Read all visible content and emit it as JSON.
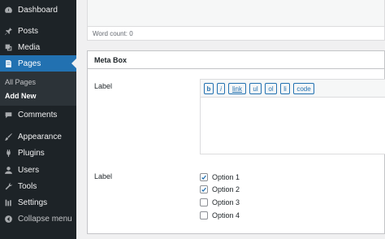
{
  "sidebar": {
    "items": [
      {
        "label": "Dashboard",
        "icon": "dashboard-icon"
      },
      {
        "label": "Posts",
        "icon": "pin-icon"
      },
      {
        "label": "Media",
        "icon": "media-icon"
      },
      {
        "label": "Pages",
        "icon": "pages-icon",
        "active": true
      },
      {
        "label": "Comments",
        "icon": "comment-icon"
      },
      {
        "label": "Appearance",
        "icon": "brush-icon"
      },
      {
        "label": "Plugins",
        "icon": "plug-icon"
      },
      {
        "label": "Users",
        "icon": "user-icon"
      },
      {
        "label": "Tools",
        "icon": "wrench-icon"
      },
      {
        "label": "Settings",
        "icon": "settings-icon"
      },
      {
        "label": "Collapse menu",
        "icon": "collapse-icon"
      }
    ],
    "submenu": [
      {
        "label": "All Pages"
      },
      {
        "label": "Add New",
        "current": true
      }
    ]
  },
  "editor": {
    "word_count": "Word count: 0"
  },
  "metabox": {
    "title": "Meta Box",
    "field1_label": "Label",
    "toolbar": [
      "b",
      "i",
      "link",
      "ul",
      "ol",
      "li",
      "code"
    ],
    "field2_label": "Label",
    "options": [
      {
        "label": "Option 1",
        "checked": true
      },
      {
        "label": "Option 2",
        "checked": true
      },
      {
        "label": "Option 3",
        "checked": false
      },
      {
        "label": "Option 4",
        "checked": false
      }
    ]
  },
  "colors": {
    "sidebar_bg": "#1d2327",
    "accent": "#2271b1",
    "submenu_bg": "#2c3338"
  }
}
